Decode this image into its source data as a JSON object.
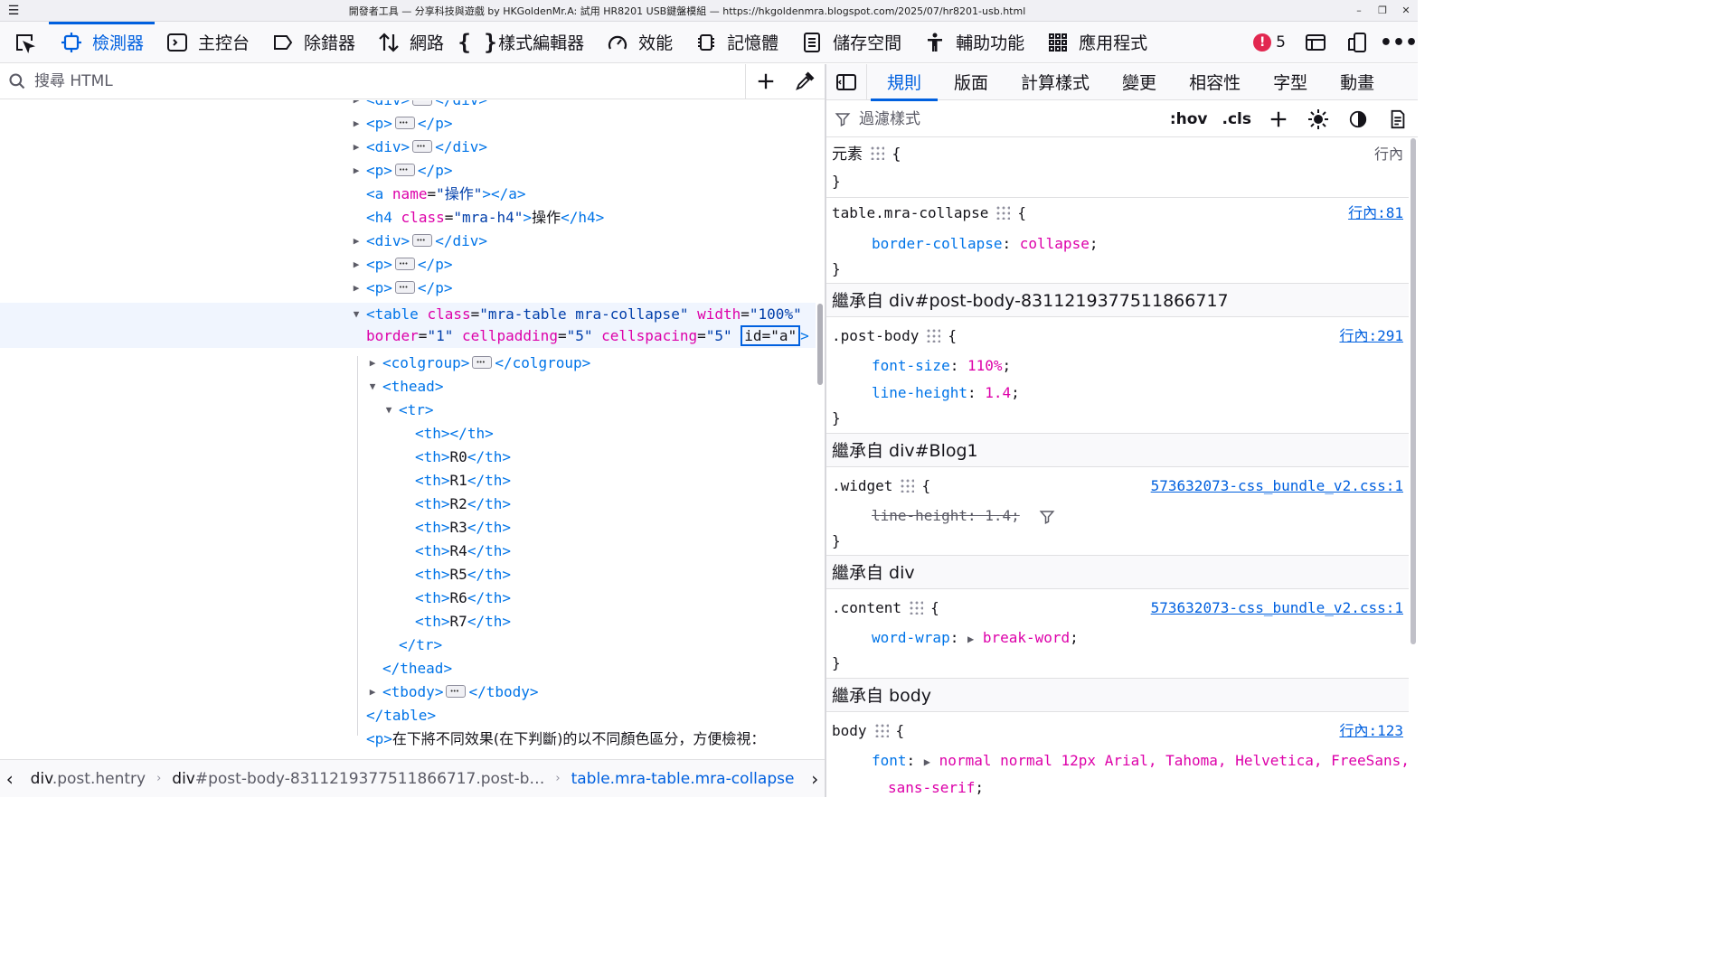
{
  "window": {
    "title": "開發者工具 — 分享科技與遊戲 by HKGoldenMr.A: 試用 HR8201 USB鍵盤模組 — https://hkgoldenmra.blogspot.com/2025/07/hr8201-usb.html"
  },
  "toolbar": {
    "tabs": [
      {
        "label": "檢測器",
        "icon": "inspector-icon"
      },
      {
        "label": "主控台",
        "icon": "console-icon"
      },
      {
        "label": "除錯器",
        "icon": "debugger-icon"
      },
      {
        "label": "網路",
        "icon": "network-icon"
      },
      {
        "label": "樣式編輯器",
        "icon": "style-editor-icon"
      },
      {
        "label": "效能",
        "icon": "performance-icon"
      },
      {
        "label": "記憶體",
        "icon": "memory-icon"
      },
      {
        "label": "儲存空間",
        "icon": "storage-icon"
      },
      {
        "label": "輔助功能",
        "icon": "accessibility-icon"
      },
      {
        "label": "應用程式",
        "icon": "application-icon"
      }
    ],
    "error_count": "5",
    "accent": "#0060df"
  },
  "search": {
    "placeholder": "搜尋 HTML"
  },
  "markup": {
    "r0": {
      "tag": "div",
      "close": "div"
    },
    "r1": {
      "tag": "p",
      "close": "p"
    },
    "r2": {
      "tag": "div",
      "close": "div"
    },
    "r3": {
      "tag": "p",
      "close": "p"
    },
    "r4": {
      "tag": "a",
      "attr": "name",
      "val": "\"操作\"",
      "close": "a"
    },
    "r5": {
      "tag": "h4",
      "attr": "class",
      "val": "\"mra-h4\"",
      "text": "操作",
      "close": "h4"
    },
    "r6": {
      "tag": "div",
      "close": "div"
    },
    "r7": {
      "tag": "p",
      "close": "p"
    },
    "r8": {
      "tag": "p",
      "close": "p"
    },
    "r9": {
      "tag": "table",
      "a1": "class",
      "v1": "\"mra-table mra-collapse\"",
      "a2": "width",
      "v2": "\"100%\"",
      "a3": "border",
      "v3": "\"1\"",
      "a4": "cellpadding",
      "v4": "\"5\"",
      "a5": "cellspacing",
      "v5": "\"5\"",
      "id": "id=\"a\""
    },
    "r10": {
      "tag": "colgroup",
      "close": "colgroup"
    },
    "r11": {
      "tag": "thead"
    },
    "r12": {
      "tag": "tr"
    },
    "th_rows": [
      {
        "text": ""
      },
      {
        "text": "R0"
      },
      {
        "text": "R1"
      },
      {
        "text": "R2"
      },
      {
        "text": "R3"
      },
      {
        "text": "R4"
      },
      {
        "text": "R5"
      },
      {
        "text": "R6"
      },
      {
        "text": "R7"
      }
    ],
    "th_tag": "th",
    "r22": {
      "close": "tr"
    },
    "r23": {
      "close": "thead"
    },
    "r24": {
      "tag": "tbody",
      "close": "tbody"
    },
    "r25": {
      "close": "table"
    },
    "r26": {
      "tag": "p",
      "text": "在下將不同效果(在下判斷)的以不同顏色區分，方便檢視："
    }
  },
  "breadcrumbs": [
    {
      "tag": "div",
      "cls": ".post.hentry"
    },
    {
      "tag": "div",
      "cls": "#post-body-8311219377511866717.post-b…"
    },
    {
      "tag": "table.mra-table.mra-collapse",
      "cls": ""
    }
  ],
  "rules_tabs": [
    "規則",
    "版面",
    "計算樣式",
    "變更",
    "相容性",
    "字型",
    "動畫"
  ],
  "filter": {
    "placeholder": "過濾樣式",
    "hov": ":hov",
    "cls": ".cls"
  },
  "rules": {
    "element": {
      "selector": "元素",
      "source": "行內",
      "open": "{",
      "close": "}"
    },
    "table": {
      "selector": "table.mra-collapse",
      "source": "行內:81",
      "prop": "border-collapse",
      "value": "collapse"
    },
    "inherit1": "繼承自 div#post-body-8311219377511866717",
    "postbody": {
      "selector": ".post-body",
      "source": "行內:291",
      "p1": "font-size",
      "v1": "110%",
      "p2": "line-height",
      "v2": "1.4"
    },
    "inherit2": "繼承自 div#Blog1",
    "widget": {
      "selector": ".widget",
      "source": "573632073-css_bundle_v2.css:1",
      "decl": "line-height: 1.4;"
    },
    "inherit3": "繼承自 div",
    "content": {
      "selector": ".content",
      "source": "573632073-css_bundle_v2.css:1",
      "prop": "word-wrap",
      "value": "break-word"
    },
    "inherit4": "繼承自 body",
    "body": {
      "selector": "body",
      "source": "行內:123",
      "prop": "font",
      "value": "normal normal 12px Arial, Tahoma, Helvetica, FreeSans,",
      "value2": "sans-serif"
    }
  }
}
